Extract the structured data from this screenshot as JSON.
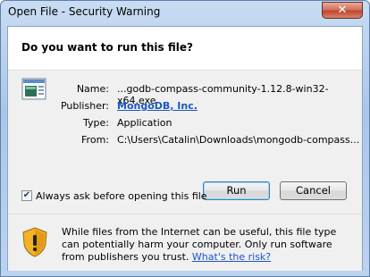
{
  "window": {
    "title": "Open File - Security Warning",
    "close_symbol": "✕"
  },
  "dialog": {
    "heading": "Do you want to run this file?",
    "fields": {
      "name_label": "Name:",
      "name_value": "...godb-compass-community-1.12.8-win32-x64.exe",
      "publisher_label": "Publisher:",
      "publisher_value": "MongoDB, Inc.",
      "type_label": "Type:",
      "type_value": "Application",
      "from_label": "From:",
      "from_value": "C:\\Users\\Catalin\\Downloads\\mongodb-compass..."
    },
    "buttons": {
      "run": "Run",
      "cancel": "Cancel"
    },
    "checkbox": {
      "label": "Always ask before opening this file",
      "checked": true
    },
    "warning": {
      "text": "While files from the Internet can be useful, this file type can potentially harm your computer. Only run software from publishers you trust.",
      "link": "What's the risk?"
    }
  },
  "icons": {
    "file": "application-file-icon",
    "shield": "shield-warning-icon",
    "close": "close-icon"
  }
}
